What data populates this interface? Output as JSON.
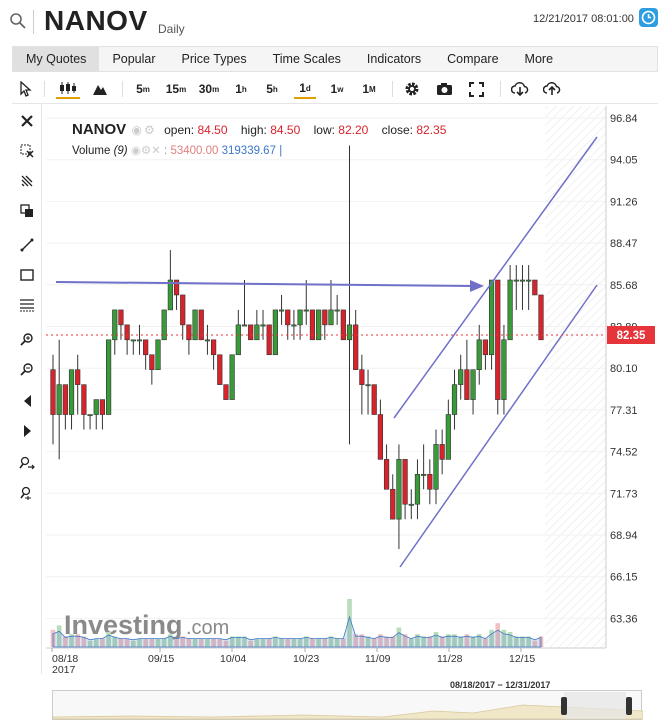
{
  "header": {
    "symbol": "NANOV",
    "timeframe": "Daily",
    "datetime": "12/21/2017 08:01:00"
  },
  "menu": {
    "items": [
      "My Quotes",
      "Popular",
      "Price Types",
      "Time Scales",
      "Indicators",
      "Compare",
      "More"
    ]
  },
  "toolbar": {
    "intervals": [
      {
        "n": "5",
        "u": "m"
      },
      {
        "n": "15",
        "u": "m"
      },
      {
        "n": "30",
        "u": "m"
      },
      {
        "n": "1",
        "u": "h"
      },
      {
        "n": "5",
        "u": "h"
      },
      {
        "n": "1",
        "u": "d"
      },
      {
        "n": "1",
        "u": "w"
      },
      {
        "n": "1",
        "u": "M"
      }
    ],
    "selected_interval": "1d"
  },
  "legend": {
    "symbol": "NANOV",
    "open_label": "open:",
    "open": "84.50",
    "high_label": "high:",
    "high": "84.50",
    "low_label": "low:",
    "low": "82.20",
    "close_label": "close:",
    "close": "82.35",
    "volume_label": "Volume",
    "volume_period": "(9)",
    "volume_value": "53400.00",
    "volume_ma": "319339.67"
  },
  "watermark": {
    "brand": "Investing",
    "suffix": ".com"
  },
  "navigator": {
    "range": "08/18/2017 − 12/31/2017"
  },
  "colors": {
    "up": "#3a9a3a",
    "down": "#d9232b",
    "trendline": "#7070c8",
    "last_price": "#e5343a"
  },
  "chart_data": {
    "type": "candlestick",
    "y_ticks": [
      "96.84",
      "94.05",
      "91.26",
      "88.47",
      "85.68",
      "82.89",
      "80.10",
      "77.31",
      "74.52",
      "71.73",
      "68.94",
      "66.15",
      "63.36"
    ],
    "x_ticks": [
      "08/18\n2017",
      "09/15",
      "10/04",
      "10/23",
      "11/09",
      "11/28",
      "12/15"
    ],
    "last_price": "82.35",
    "ohlc": [
      [
        80,
        81,
        75,
        77
      ],
      [
        77,
        82,
        74,
        79
      ],
      [
        79,
        79,
        76,
        77
      ],
      [
        77,
        80,
        76,
        80
      ],
      [
        80,
        81,
        77,
        79
      ],
      [
        79,
        79,
        76,
        77
      ],
      [
        77,
        77,
        76,
        77
      ],
      [
        77,
        78,
        76,
        78
      ],
      [
        78,
        78,
        76,
        77
      ],
      [
        77,
        82,
        77,
        82
      ],
      [
        82,
        84,
        81,
        84
      ],
      [
        84,
        84,
        82,
        83
      ],
      [
        83,
        83,
        81,
        82
      ],
      [
        82,
        82,
        81,
        82
      ],
      [
        82,
        83,
        81,
        82
      ],
      [
        82,
        82,
        80,
        81
      ],
      [
        81,
        81,
        79,
        80
      ],
      [
        80,
        82,
        80,
        82
      ],
      [
        82,
        84,
        82,
        84
      ],
      [
        84,
        88,
        84,
        86
      ],
      [
        86,
        86,
        84,
        85
      ],
      [
        85,
        85,
        82,
        83
      ],
      [
        83,
        83,
        81,
        82
      ],
      [
        82,
        84,
        82,
        84
      ],
      [
        84,
        84,
        82,
        82
      ],
      [
        82,
        83,
        81,
        82
      ],
      [
        82,
        82,
        80,
        81
      ],
      [
        81,
        81,
        79,
        79
      ],
      [
        79,
        79,
        78,
        78
      ],
      [
        78,
        81,
        78,
        81
      ],
      [
        81,
        84,
        81,
        83
      ],
      [
        83,
        86,
        83,
        83
      ],
      [
        83,
        83,
        82,
        82
      ],
      [
        82,
        84,
        82,
        83
      ],
      [
        83,
        84,
        82,
        83
      ],
      [
        83,
        83,
        81,
        81
      ],
      [
        81,
        84,
        81,
        84
      ],
      [
        84,
        85,
        83,
        84
      ],
      [
        84,
        84,
        82,
        83
      ],
      [
        83,
        84,
        82,
        83
      ],
      [
        83,
        84,
        82,
        84
      ],
      [
        84,
        86,
        83,
        84
      ],
      [
        84,
        84,
        82,
        82
      ],
      [
        82,
        84,
        82,
        84
      ],
      [
        84,
        84,
        82,
        83
      ],
      [
        83,
        86,
        83,
        84
      ],
      [
        84,
        85,
        83,
        84
      ],
      [
        84,
        84,
        82,
        82
      ],
      [
        82,
        95,
        75,
        83
      ],
      [
        83,
        84,
        80,
        80
      ],
      [
        80,
        81,
        77,
        79
      ],
      [
        79,
        80,
        77,
        79
      ],
      [
        79,
        79,
        77,
        77
      ],
      [
        77,
        78,
        74,
        74
      ],
      [
        74,
        75,
        72,
        72
      ],
      [
        72,
        73,
        70,
        70
      ],
      [
        70,
        75,
        68,
        74
      ],
      [
        74,
        74,
        70,
        71
      ],
      [
        71,
        72,
        70,
        71
      ],
      [
        71,
        74,
        70,
        73
      ],
      [
        73,
        75,
        72,
        73
      ],
      [
        73,
        74,
        71,
        72
      ],
      [
        72,
        76,
        71,
        75
      ],
      [
        75,
        76,
        73,
        74
      ],
      [
        74,
        78,
        74,
        77
      ],
      [
        77,
        80,
        76,
        79
      ],
      [
        79,
        81,
        78,
        80
      ],
      [
        80,
        82,
        78,
        78
      ],
      [
        78,
        80,
        77,
        80
      ],
      [
        80,
        83,
        79,
        82
      ],
      [
        82,
        82,
        80,
        81
      ],
      [
        81,
        86,
        80,
        86
      ],
      [
        86,
        86,
        77,
        78
      ],
      [
        78,
        83,
        77,
        82
      ],
      [
        82,
        87,
        82,
        86
      ],
      [
        86,
        87,
        84,
        86
      ],
      [
        86,
        87,
        84,
        86
      ],
      [
        86,
        87,
        84,
        86
      ],
      [
        86,
        86,
        85,
        85
      ],
      [
        85,
        85,
        82,
        82
      ]
    ]
  }
}
